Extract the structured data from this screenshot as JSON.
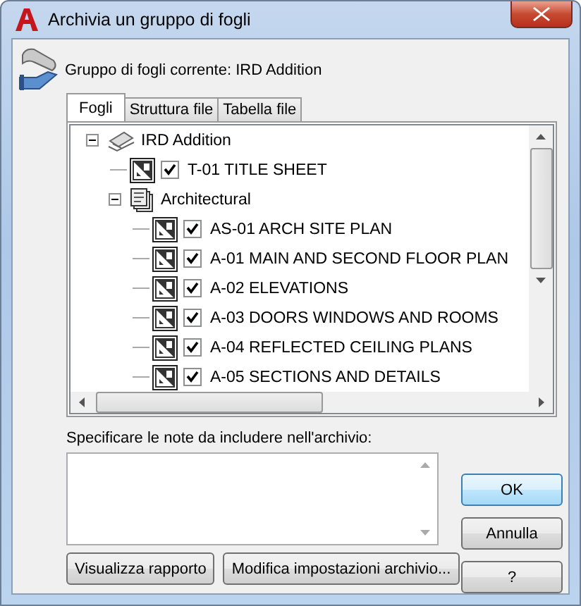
{
  "window": {
    "title": "Archivia un gruppo di fogli"
  },
  "current_set": {
    "label": "Gruppo di fogli corrente: IRD Addition"
  },
  "tabs": [
    {
      "label": "Fogli",
      "selected": true
    },
    {
      "label": "Struttura file",
      "selected": false
    },
    {
      "label": "Tabella file",
      "selected": false
    }
  ],
  "tree": [
    {
      "kind": "set",
      "label": "IRD Addition",
      "expanded": true,
      "children": [
        {
          "kind": "sheet",
          "label": "T-01 TITLE SHEET",
          "checked": true
        },
        {
          "kind": "subset",
          "label": "Architectural",
          "expanded": true,
          "children": [
            {
              "kind": "sheet",
              "label": "AS-01 ARCH SITE PLAN",
              "checked": true
            },
            {
              "kind": "sheet",
              "label": "A-01 MAIN AND SECOND FLOOR PLAN",
              "checked": true
            },
            {
              "kind": "sheet",
              "label": "A-02 ELEVATIONS",
              "checked": true
            },
            {
              "kind": "sheet",
              "label": "A-03 DOORS WINDOWS AND ROOMS",
              "checked": true
            },
            {
              "kind": "sheet",
              "label": "A-04 REFLECTED CEILING PLANS",
              "checked": true
            },
            {
              "kind": "sheet",
              "label": "A-05 SECTIONS AND DETAILS",
              "checked": true
            }
          ]
        }
      ]
    }
  ],
  "notes": {
    "label": "Specificare le note da includere nell'archivio:"
  },
  "buttons": [
    {
      "kind": "default",
      "label": "OK"
    },
    {
      "kind": "normal",
      "label": "Annulla"
    },
    {
      "kind": "normal",
      "label": "?"
    }
  ],
  "bottom_buttons": [
    {
      "label": "Visualizza rapporto"
    },
    {
      "label": "Modifica impostazioni archivio..."
    }
  ]
}
